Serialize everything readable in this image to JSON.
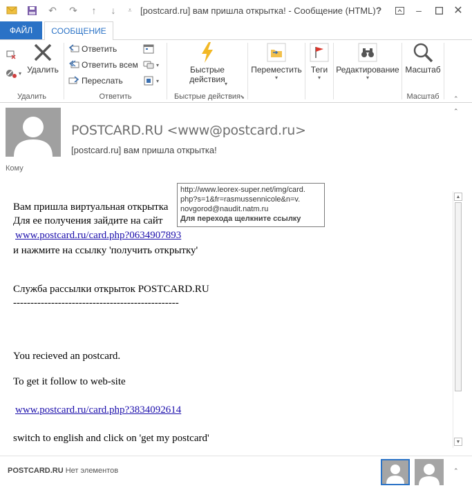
{
  "window": {
    "title": "[postcard.ru] вам пришла открытка! - Сообщение (HTML)"
  },
  "tabs": [
    {
      "label": "ФАЙЛ"
    },
    {
      "label": "СООБЩЕНИЕ"
    }
  ],
  "ribbon": {
    "delete_group": {
      "delete_label": "Удалить",
      "group_label": "Удалить"
    },
    "respond_group": {
      "reply": "Ответить",
      "reply_all": "Ответить всем",
      "forward": "Переслать",
      "group_label": "Ответить"
    },
    "quick_steps": {
      "label_line1": "Быстрые",
      "label_line2": "действия",
      "group_label": "Быстрые действия"
    },
    "move": {
      "label": "Переместить"
    },
    "tags": {
      "label": "Теги"
    },
    "editing": {
      "label": "Редактирование"
    },
    "zoom": {
      "label": "Масштаб",
      "group_label": "Масштаб"
    }
  },
  "header": {
    "sender": "POSTCARD.RU <www@postcard.ru>",
    "subject": "[postcard.ru] вам пришла открытка!",
    "to_label": "Кому"
  },
  "tooltip": {
    "line1": "http://www.leorex-super.net/img/card.",
    "line2": "php?s=1&fr=rasmussennicole&n=v.",
    "line3": "novgorod@naudit.natm.ru",
    "hint": "Для перехода щелкните ссылку"
  },
  "body": {
    "line1": "Вам пришла виртуальная открытка",
    "line2": "Для ее получения зайдите на сайт",
    "link1": "www.postcard.ru/card.php?0634907893",
    "line3": "и нажмите на ссылку 'получить открытку'",
    "line4": "Служба рассылки открыток POSTCARD.RU",
    "divider": "------------------------------------------------",
    "line5": "You recieved an postcard.",
    "line6": "To get it follow to web-site",
    "link2": "www.postcard.ru/card.php?3834092614",
    "line7": "switch to english and click on 'get my postcard'"
  },
  "bottom": {
    "sender_name": "POSTCARD.RU",
    "status": "Нет элементов"
  },
  "colors": {
    "accent": "#2a72c6",
    "link": "#1a0dab",
    "avatar": "#a0a0a0"
  }
}
